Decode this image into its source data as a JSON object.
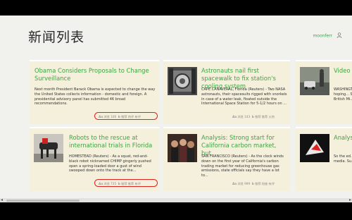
{
  "page": {
    "title": "新闻列表",
    "user_name": "moonferr"
  },
  "cards": [
    {
      "title": "Obama Considers Proposals to Change Surveillance",
      "body": "Next month President Barack Obama is expected to change the way the United States collects information - domestic and foreign.  A presidential advisory panel has submitted 46 broad recommendations.",
      "views_label": "浏览 106",
      "actions": "推荐 热评 有评"
    },
    {
      "title": "Astronauts nail first spacewalk to fix station's cooling system",
      "body": "CAPE CANAVERAL, Florida (Reuters) - Two NASA astronauts, their spacesuits rigged with snorkels in case of a water leak, floated outside the International Space Station for 5-1/2 hours on ...",
      "views_label": "浏览 143",
      "actions": "推荐 推荐 火热"
    },
    {
      "title": "Video fightin",
      "body": "WASHINGT... is hoping... Syria with... British Mi...",
      "views_label": "",
      "actions": ""
    },
    {
      "title": "Robots to the rescue at international trials in Florida",
      "body": "HOMESTEAD (Reuters) - As a squat, red-and-black robot nicknamed CHIMP gingerly pushed open a spring-loaded door a gust of wind swooped down onto the track at the...",
      "views_label": "浏览 735",
      "actions": "推荐 推荐 有评"
    },
    {
      "title": "Analysis: Strong start for California carbon market, but",
      "body": "SAN FRANCISCO (Reuters) - As the clock winds down on the first year of California's carbon trading market for reducing greenhouse gas emissions, state officials say they have a lot to...",
      "views_label": "浏览 999",
      "actions": "推荐 抢座 有评"
    },
    {
      "title": "Analys tiny ro",
      "body": "So the ed... publicity ... media. Su... singer La...",
      "views_label": "",
      "actions": ""
    }
  ],
  "scroll": {
    "left_arrow": "◂",
    "right_arrow": "▸"
  },
  "colors": {
    "title_green": "#3ea342",
    "card_bg": "#f5f0dc",
    "highlight": "#e02020"
  }
}
